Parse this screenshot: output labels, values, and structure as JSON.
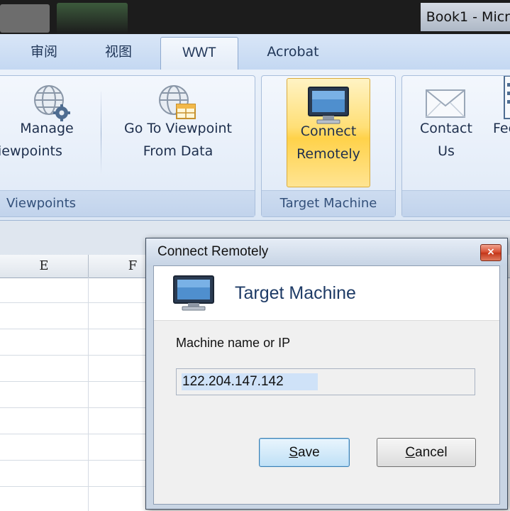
{
  "window": {
    "title": "Book1 - Micr"
  },
  "ribbon": {
    "tabs": [
      "审阅",
      "视图",
      "WWT",
      "Acrobat"
    ],
    "active_tab": "WWT",
    "groups": [
      {
        "label": "Viewpoints",
        "buttons": [
          {
            "line1": "Manage",
            "line2": "Viewpoints"
          },
          {
            "line1": "Go To Viewpoint",
            "line2": "From Data"
          }
        ]
      },
      {
        "label": "Target Machine",
        "buttons": [
          {
            "line1": "Connect",
            "line2": "Remotely"
          }
        ]
      },
      {
        "label": "",
        "buttons": [
          {
            "line1": "Contact",
            "line2": "Us"
          },
          {
            "line1": "Feed",
            "line2": ""
          }
        ]
      }
    ],
    "viewpoints_label_visible": "Viewpoints",
    "manage_line2_visible": "iewpoints"
  },
  "sheet": {
    "columns": [
      "E",
      "F"
    ]
  },
  "dialog": {
    "title": "Connect Remotely",
    "close_glyph": "×",
    "header": "Target Machine",
    "field_label": "Machine name or IP",
    "field_value": "122.204.147.142",
    "save": {
      "mnemonic": "S",
      "rest": "ave"
    },
    "cancel": {
      "mnemonic": "C",
      "rest": "ancel"
    }
  },
  "colors": {
    "accent": "#ffd24a",
    "ribbon": "#dce7f5",
    "close": "#d4482b"
  },
  "icons": [
    "globe-gear-icon",
    "globe-table-icon",
    "monitor-icon",
    "envelope-icon",
    "feedback-icon"
  ]
}
